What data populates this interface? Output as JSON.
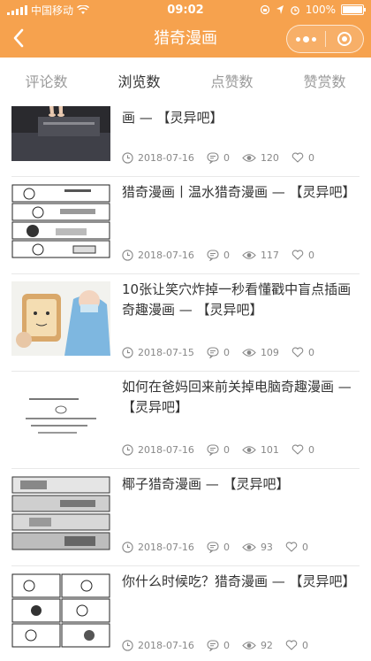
{
  "status_bar": {
    "carrier": "中国移动",
    "time": "09:02",
    "battery": "100%"
  },
  "navbar": {
    "title": "猎奇漫画"
  },
  "tabs": [
    {
      "label": "评论数"
    },
    {
      "label": "浏览数"
    },
    {
      "label": "点赞数"
    },
    {
      "label": "赞赏数"
    }
  ],
  "articles": [
    {
      "title": "画 — 【灵异吧】",
      "date": "2018-07-16",
      "comments": "0",
      "views": "120",
      "likes": "0"
    },
    {
      "title": "猎奇漫画丨温水猎奇漫画 — 【灵异吧】",
      "date": "2018-07-16",
      "comments": "0",
      "views": "117",
      "likes": "0"
    },
    {
      "title": "10张让笑穴炸掉一秒看懂戳中盲点插画奇趣漫画 — 【灵异吧】",
      "date": "2018-07-15",
      "comments": "0",
      "views": "109",
      "likes": "0"
    },
    {
      "title": "如何在爸妈回来前关掉电脑奇趣漫画 — 【灵异吧】",
      "date": "2018-07-16",
      "comments": "0",
      "views": "101",
      "likes": "0"
    },
    {
      "title": "椰子猎奇漫画 — 【灵异吧】",
      "date": "2018-07-16",
      "comments": "0",
      "views": "93",
      "likes": "0"
    },
    {
      "title": "你什么时候吃？猎奇漫画 — 【灵异吧】",
      "date": "2018-07-16",
      "comments": "0",
      "views": "92",
      "likes": "0"
    }
  ]
}
